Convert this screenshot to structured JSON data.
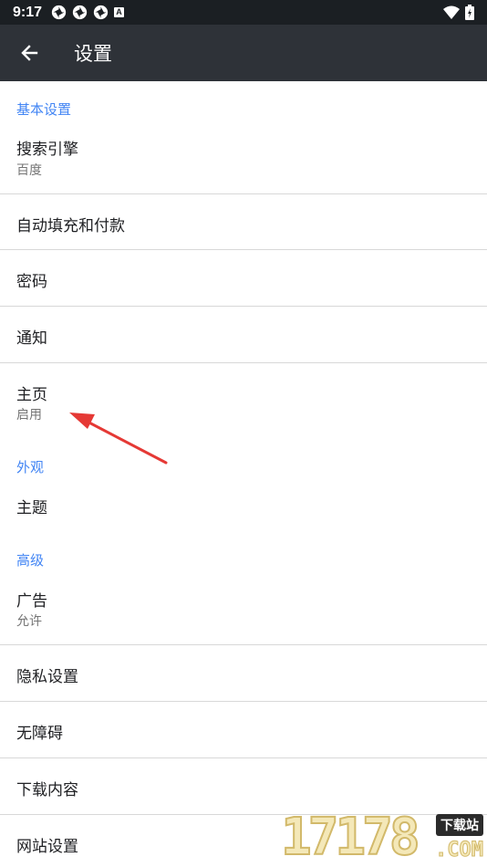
{
  "status_bar": {
    "time": "9:17",
    "notification_badge": "A",
    "icons": [
      "pinwheel-icon",
      "pinwheel-icon",
      "pinwheel-icon",
      "a-badge-icon",
      "wifi-icon",
      "battery-icon"
    ]
  },
  "app_bar": {
    "back_icon": "arrow-back-icon",
    "title": "设置",
    "background": "#2e3238"
  },
  "sections": {
    "basic": {
      "header": "基本设置",
      "search_engine": {
        "title": "搜索引擎",
        "value": "百度"
      },
      "autofill": {
        "title": "自动填充和付款"
      },
      "passwords": {
        "title": "密码"
      },
      "notifications": {
        "title": "通知"
      },
      "homepage": {
        "title": "主页",
        "value": "启用"
      }
    },
    "appearance": {
      "header": "外观",
      "theme": {
        "title": "主题"
      }
    },
    "advanced": {
      "header": "高级",
      "ads": {
        "title": "广告",
        "value": "允许"
      },
      "privacy": {
        "title": "隐私设置"
      },
      "accessibility": {
        "title": "无障碍"
      },
      "downloads": {
        "title": "下载内容"
      },
      "site_settings": {
        "title": "网站设置"
      }
    }
  },
  "annotation": {
    "color": "#e53935"
  },
  "watermark": {
    "digits": "17178",
    "tag": "下载站",
    "suffix": ".COM"
  },
  "colors": {
    "accent": "#4285f4",
    "status_bar": "#1b1f23",
    "divider": "#d8d8d8"
  }
}
